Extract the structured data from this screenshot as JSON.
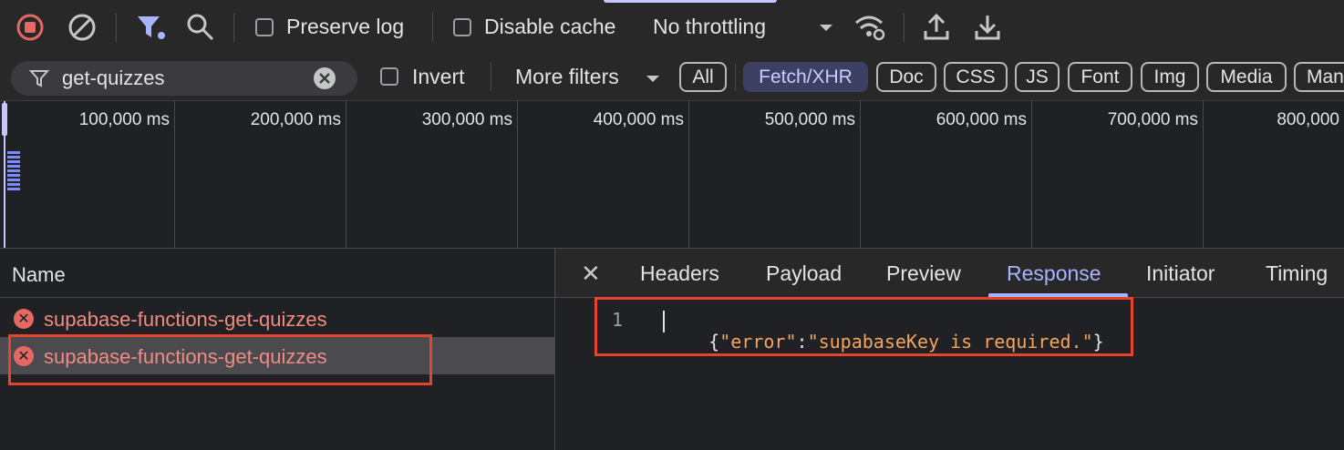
{
  "toolbar": {
    "preserve_log_label": "Preserve log",
    "disable_cache_label": "Disable cache",
    "throttling_value": "No throttling"
  },
  "filter": {
    "value": "get-quizzes",
    "invert_label": "Invert",
    "more_filters_label": "More filters",
    "chips": [
      "All",
      "Fetch/XHR",
      "Doc",
      "CSS",
      "JS",
      "Font",
      "Img",
      "Media",
      "Man"
    ],
    "active_chip": "Fetch/XHR"
  },
  "overview": {
    "ticks": [
      "100,000 ms",
      "200,000 ms",
      "300,000 ms",
      "400,000 ms",
      "500,000 ms",
      "600,000 ms",
      "700,000 ms",
      "800,000"
    ]
  },
  "requests": {
    "header": "Name",
    "rows": [
      {
        "name": "supabase-functions-get-quizzes",
        "status": "error"
      },
      {
        "name": "supabase-functions-get-quizzes",
        "status": "error",
        "selected": true
      }
    ]
  },
  "details": {
    "close_glyph": "✕",
    "tabs": [
      "Headers",
      "Payload",
      "Preview",
      "Response",
      "Initiator",
      "Timing"
    ],
    "active_tab": "Response"
  },
  "response": {
    "line_number": "1",
    "open_brace": "{",
    "key": "\"error\"",
    "colon": ":",
    "value": "\"supabaseKey is required.\"",
    "close_brace": "}"
  },
  "colors": {
    "accent": "#a8b4ff",
    "error": "#e46962",
    "highlight": "#e8442c"
  }
}
